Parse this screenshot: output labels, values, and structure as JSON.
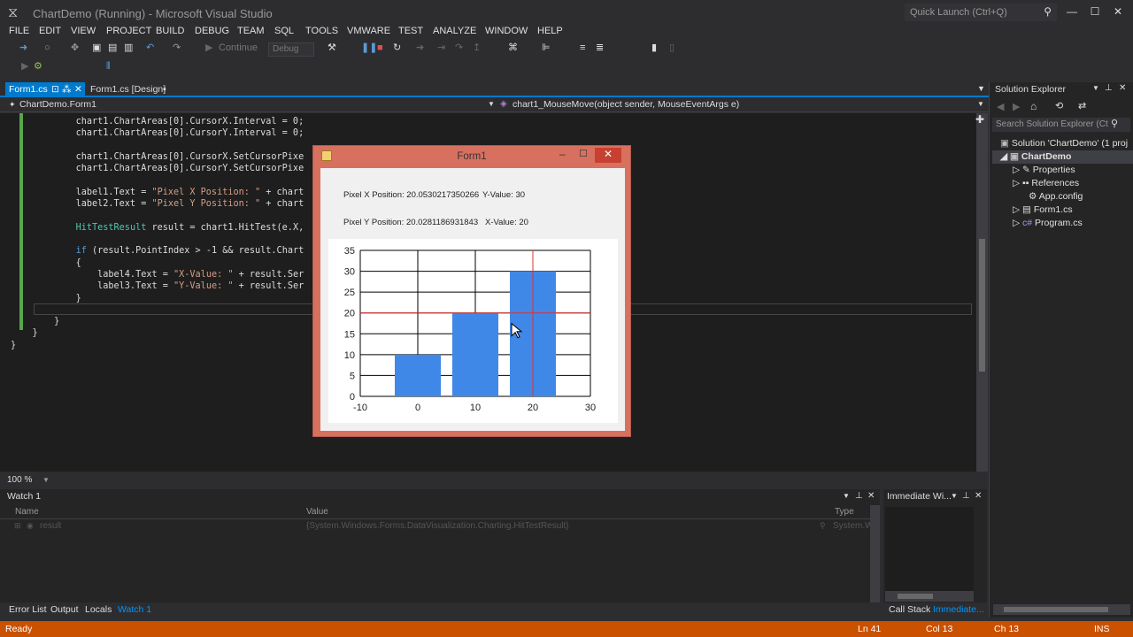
{
  "window": {
    "title": "ChartDemo (Running) - Microsoft Visual Studio",
    "quick_launch": "Quick Launch (Ctrl+Q)"
  },
  "menu": [
    "FILE",
    "EDIT",
    "VIEW",
    "PROJECT",
    "BUILD",
    "DEBUG",
    "TEAM",
    "SQL",
    "TOOLS",
    "VMWARE",
    "TEST",
    "ANALYZE",
    "WINDOW",
    "HELP"
  ],
  "toolbar": {
    "continue_label": "Continue",
    "config_combo": "Debug"
  },
  "tabs": {
    "active": "Form1.cs",
    "second": "Form1.cs [Design]"
  },
  "nav": {
    "class": "ChartDemo.Form1",
    "member": "chart1_MouseMove(object sender, MouseEventArgs e)"
  },
  "code": [
    "            chart1.ChartAreas[0].CursorX.Interval = 0;",
    "            chart1.ChartAreas[0].CursorY.Interval = 0;",
    "",
    "            chart1.ChartAreas[0].CursorX.SetCursorPixe",
    "            chart1.ChartAreas[0].CursorY.SetCursorPixe",
    "",
    "            label1.Text = \"Pixel X Position: \" + chart",
    "            label2.Text = \"Pixel Y Position: \" + chart",
    "",
    "            HitTestResult result = chart1.HitTest(e.X,",
    "",
    "            if (result.PointIndex > -1 && result.Chart",
    "            {",
    "                label4.Text = \"X-Value: \" + result.Ser",
    "                label3.Text = \"Y-Value: \" + result.Ser",
    "            }",
    "",
    "        }",
    "    }",
    "}"
  ],
  "zoom": "100 %",
  "form1": {
    "title": "Form1",
    "label1": "Pixel X Position: 20.0530217350266",
    "label3": "Y-Value: 30",
    "label2": "Pixel Y Position: 20.0281186931843",
    "label4": "X-Value: 20"
  },
  "chart_data": {
    "type": "bar",
    "x": [
      0,
      10,
      20
    ],
    "values": [
      10,
      20,
      30
    ],
    "xlim": [
      -10,
      30
    ],
    "ylim": [
      0,
      35
    ],
    "x_ticks": [
      "-10",
      "0",
      "10",
      "20",
      "30"
    ],
    "y_ticks": [
      "0",
      "5",
      "10",
      "15",
      "20",
      "25",
      "30",
      "35"
    ],
    "cursor": {
      "x": 20,
      "y": 20
    },
    "bar_color": "#4088e8",
    "cursor_color": "#e03030",
    "grid": true
  },
  "solution_explorer": {
    "title": "Solution Explorer",
    "search": "Search Solution Explorer (Ct",
    "items": [
      "Solution 'ChartDemo' (1 proj",
      "ChartDemo",
      "Properties",
      "References",
      "App.config",
      "Form1.cs",
      "Program.cs"
    ]
  },
  "watch": {
    "title": "Watch 1",
    "cols": [
      "Name",
      "Value",
      "Type"
    ],
    "row": {
      "name": "result",
      "value": "{System.Windows.Forms.DataVisualization.Charting.HitTestResult}",
      "type": "System.W"
    }
  },
  "immediate": {
    "title": "Immediate Wi..."
  },
  "bottom_tabs": [
    "Error List",
    "Output",
    "Locals",
    "Watch 1"
  ],
  "right_bottom_tabs": [
    "Call Stack",
    "Immediate..."
  ],
  "status": {
    "text": "Ready",
    "ln": "Ln 41",
    "col": "Col 13",
    "ch": "Ch 13",
    "mode": "INS"
  }
}
